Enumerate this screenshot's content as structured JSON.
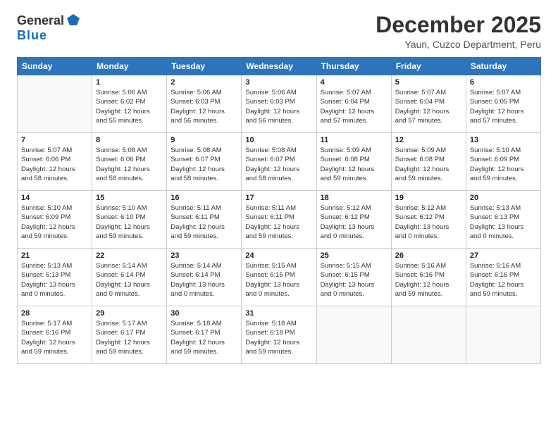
{
  "logo": {
    "general": "General",
    "blue": "Blue"
  },
  "title": "December 2025",
  "subtitle": "Yauri, Cuzco Department, Peru",
  "days_of_week": [
    "Sunday",
    "Monday",
    "Tuesday",
    "Wednesday",
    "Thursday",
    "Friday",
    "Saturday"
  ],
  "weeks": [
    [
      {
        "day": "",
        "detail": ""
      },
      {
        "day": "1",
        "detail": "Sunrise: 5:06 AM\nSunset: 6:02 PM\nDaylight: 12 hours\nand 55 minutes."
      },
      {
        "day": "2",
        "detail": "Sunrise: 5:06 AM\nSunset: 6:03 PM\nDaylight: 12 hours\nand 56 minutes."
      },
      {
        "day": "3",
        "detail": "Sunrise: 5:06 AM\nSunset: 6:03 PM\nDaylight: 12 hours\nand 56 minutes."
      },
      {
        "day": "4",
        "detail": "Sunrise: 5:07 AM\nSunset: 6:04 PM\nDaylight: 12 hours\nand 57 minutes."
      },
      {
        "day": "5",
        "detail": "Sunrise: 5:07 AM\nSunset: 6:04 PM\nDaylight: 12 hours\nand 57 minutes."
      },
      {
        "day": "6",
        "detail": "Sunrise: 5:07 AM\nSunset: 6:05 PM\nDaylight: 12 hours\nand 57 minutes."
      }
    ],
    [
      {
        "day": "7",
        "detail": "Sunrise: 5:07 AM\nSunset: 6:06 PM\nDaylight: 12 hours\nand 58 minutes."
      },
      {
        "day": "8",
        "detail": "Sunrise: 5:08 AM\nSunset: 6:06 PM\nDaylight: 12 hours\nand 58 minutes."
      },
      {
        "day": "9",
        "detail": "Sunrise: 5:08 AM\nSunset: 6:07 PM\nDaylight: 12 hours\nand 58 minutes."
      },
      {
        "day": "10",
        "detail": "Sunrise: 5:08 AM\nSunset: 6:07 PM\nDaylight: 12 hours\nand 58 minutes."
      },
      {
        "day": "11",
        "detail": "Sunrise: 5:09 AM\nSunset: 6:08 PM\nDaylight: 12 hours\nand 59 minutes."
      },
      {
        "day": "12",
        "detail": "Sunrise: 5:09 AM\nSunset: 6:08 PM\nDaylight: 12 hours\nand 59 minutes."
      },
      {
        "day": "13",
        "detail": "Sunrise: 5:10 AM\nSunset: 6:09 PM\nDaylight: 12 hours\nand 59 minutes."
      }
    ],
    [
      {
        "day": "14",
        "detail": "Sunrise: 5:10 AM\nSunset: 6:09 PM\nDaylight: 12 hours\nand 59 minutes."
      },
      {
        "day": "15",
        "detail": "Sunrise: 5:10 AM\nSunset: 6:10 PM\nDaylight: 12 hours\nand 59 minutes."
      },
      {
        "day": "16",
        "detail": "Sunrise: 5:11 AM\nSunset: 6:11 PM\nDaylight: 12 hours\nand 59 minutes."
      },
      {
        "day": "17",
        "detail": "Sunrise: 5:11 AM\nSunset: 6:11 PM\nDaylight: 12 hours\nand 59 minutes."
      },
      {
        "day": "18",
        "detail": "Sunrise: 5:12 AM\nSunset: 6:12 PM\nDaylight: 13 hours\nand 0 minutes."
      },
      {
        "day": "19",
        "detail": "Sunrise: 5:12 AM\nSunset: 6:12 PM\nDaylight: 13 hours\nand 0 minutes."
      },
      {
        "day": "20",
        "detail": "Sunrise: 5:13 AM\nSunset: 6:13 PM\nDaylight: 13 hours\nand 0 minutes."
      }
    ],
    [
      {
        "day": "21",
        "detail": "Sunrise: 5:13 AM\nSunset: 6:13 PM\nDaylight: 13 hours\nand 0 minutes."
      },
      {
        "day": "22",
        "detail": "Sunrise: 5:14 AM\nSunset: 6:14 PM\nDaylight: 13 hours\nand 0 minutes."
      },
      {
        "day": "23",
        "detail": "Sunrise: 5:14 AM\nSunset: 6:14 PM\nDaylight: 13 hours\nand 0 minutes."
      },
      {
        "day": "24",
        "detail": "Sunrise: 5:15 AM\nSunset: 6:15 PM\nDaylight: 13 hours\nand 0 minutes."
      },
      {
        "day": "25",
        "detail": "Sunrise: 5:15 AM\nSunset: 6:15 PM\nDaylight: 13 hours\nand 0 minutes."
      },
      {
        "day": "26",
        "detail": "Sunrise: 5:16 AM\nSunset: 6:16 PM\nDaylight: 12 hours\nand 59 minutes."
      },
      {
        "day": "27",
        "detail": "Sunrise: 5:16 AM\nSunset: 6:16 PM\nDaylight: 12 hours\nand 59 minutes."
      }
    ],
    [
      {
        "day": "28",
        "detail": "Sunrise: 5:17 AM\nSunset: 6:16 PM\nDaylight: 12 hours\nand 59 minutes."
      },
      {
        "day": "29",
        "detail": "Sunrise: 5:17 AM\nSunset: 6:17 PM\nDaylight: 12 hours\nand 59 minutes."
      },
      {
        "day": "30",
        "detail": "Sunrise: 5:18 AM\nSunset: 6:17 PM\nDaylight: 12 hours\nand 59 minutes."
      },
      {
        "day": "31",
        "detail": "Sunrise: 5:18 AM\nSunset: 6:18 PM\nDaylight: 12 hours\nand 59 minutes."
      },
      {
        "day": "",
        "detail": ""
      },
      {
        "day": "",
        "detail": ""
      },
      {
        "day": "",
        "detail": ""
      }
    ]
  ]
}
